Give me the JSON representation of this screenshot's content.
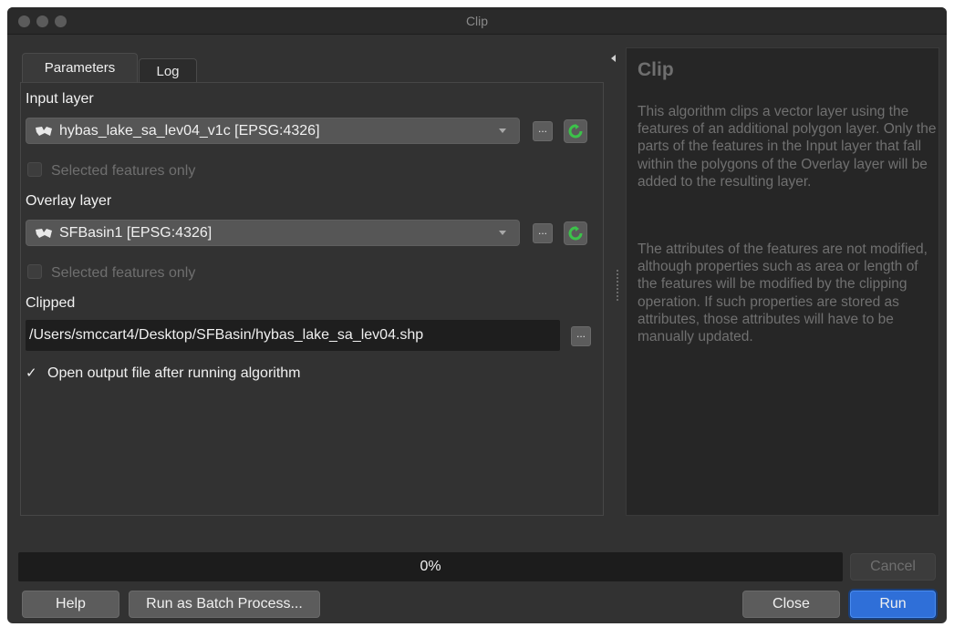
{
  "window": {
    "title": "Clip"
  },
  "tabs": [
    {
      "label": "Parameters",
      "active": true
    },
    {
      "label": "Log",
      "active": false
    }
  ],
  "input_layer": {
    "label": "Input layer",
    "value": "hybas_lake_sa_lev04_v1c [EPSG:4326]",
    "selected_only_label": "Selected features only",
    "browse_label": "..."
  },
  "overlay_layer": {
    "label": "Overlay layer",
    "value": "SFBasin1 [EPSG:4326]",
    "selected_only_label": "Selected features only",
    "browse_label": "..."
  },
  "clipped": {
    "label": "Clipped",
    "path": "/Users/smccart4/Desktop/SFBasin/hybas_lake_sa_lev04.shp",
    "browse_label": "..."
  },
  "open_output": {
    "checkmark": "✓",
    "label": "Open output file after running algorithm",
    "checked": true
  },
  "help": {
    "title": "Clip",
    "paragraphs": [
      "This algorithm clips a vector layer using the features of an additional polygon layer. Only the parts of the features in the Input layer that fall within the polygons of the Overlay layer will be added to the resulting layer.",
      "The attributes of the features are not modified, although properties such as area or length of the features will be modified by the clipping operation. If such properties are stored as attributes, those attributes will have to be manually updated."
    ]
  },
  "progress": {
    "text": "0%",
    "value": 0
  },
  "buttons": {
    "cancel": "Cancel",
    "help": "Help",
    "batch": "Run as Batch Process...",
    "close": "Close",
    "run": "Run"
  },
  "colors": {
    "accent": "#2f6fd8",
    "refresh": "#3cc24a"
  }
}
